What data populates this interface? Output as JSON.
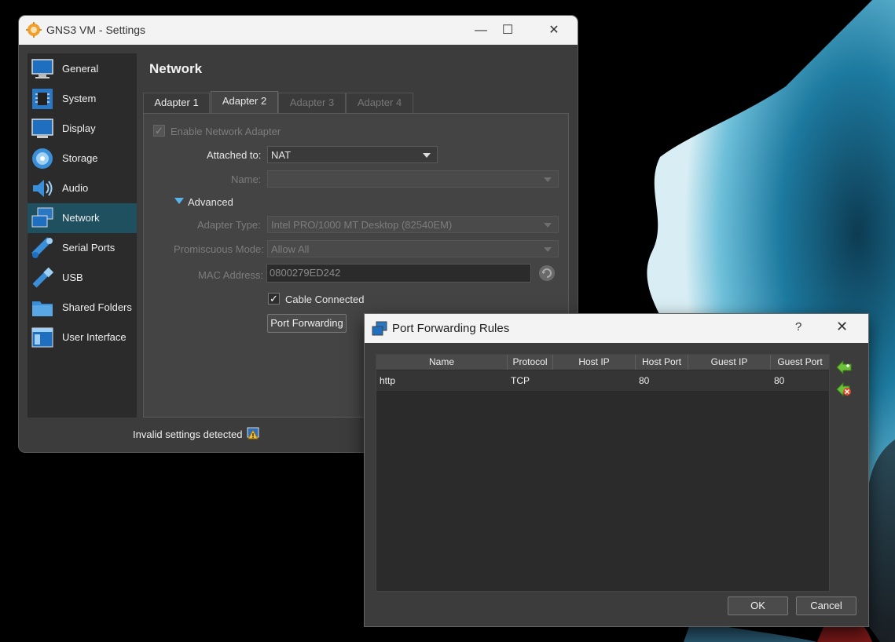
{
  "settings_window": {
    "title": "GNS3 VM - Settings",
    "controls": {
      "minimize": "—",
      "maximize": "☐",
      "close": "✕"
    },
    "sidebar": [
      {
        "label": "General",
        "icon": "monitor-icon"
      },
      {
        "label": "System",
        "icon": "chip-icon"
      },
      {
        "label": "Display",
        "icon": "display-icon"
      },
      {
        "label": "Storage",
        "icon": "disc-icon"
      },
      {
        "label": "Audio",
        "icon": "speaker-icon"
      },
      {
        "label": "Network",
        "icon": "network-icon",
        "active": true
      },
      {
        "label": "Serial Ports",
        "icon": "serial-port-icon"
      },
      {
        "label": "USB",
        "icon": "usb-icon"
      },
      {
        "label": "Shared Folders",
        "icon": "folder-icon"
      },
      {
        "label": "User Interface",
        "icon": "window-icon"
      }
    ],
    "page_title": "Network",
    "tabs": [
      {
        "label": "Adapter 1"
      },
      {
        "label": "Adapter 2",
        "active": true
      },
      {
        "label": "Adapter 3",
        "disabled": true
      },
      {
        "label": "Adapter 4",
        "disabled": true
      }
    ],
    "enable_adapter_label": "Enable Network Adapter",
    "attached_to_label": "Attached to:",
    "attached_to_value": "NAT",
    "name_label": "Name:",
    "name_value": "",
    "advanced_label": "Advanced",
    "adapter_type_label": "Adapter Type:",
    "adapter_type_value": "Intel PRO/1000 MT Desktop (82540EM)",
    "promiscuous_label": "Promiscuous Mode:",
    "promiscuous_value": "Allow All",
    "mac_label": "MAC Address:",
    "mac_value": "0800279ED242",
    "cable_connected_label": "Cable Connected",
    "port_forwarding_label": "Port Forwarding",
    "status_text": "Invalid settings detected"
  },
  "port_forwarding_dialog": {
    "title": "Port Forwarding Rules",
    "help": "?",
    "close": "✕",
    "columns": [
      "Name",
      "Protocol",
      "Host IP",
      "Host Port",
      "Guest IP",
      "Guest Port"
    ],
    "rows": [
      {
        "name": "http",
        "protocol": "TCP",
        "host_ip": "",
        "host_port": "80",
        "guest_ip": "",
        "guest_port": "80"
      }
    ],
    "ok_label": "OK",
    "cancel_label": "Cancel"
  },
  "colors": {
    "accent_selected": "#1f5060",
    "window_bg": "#3c3c3c",
    "titlebar_bg": "#f3f3f3"
  }
}
